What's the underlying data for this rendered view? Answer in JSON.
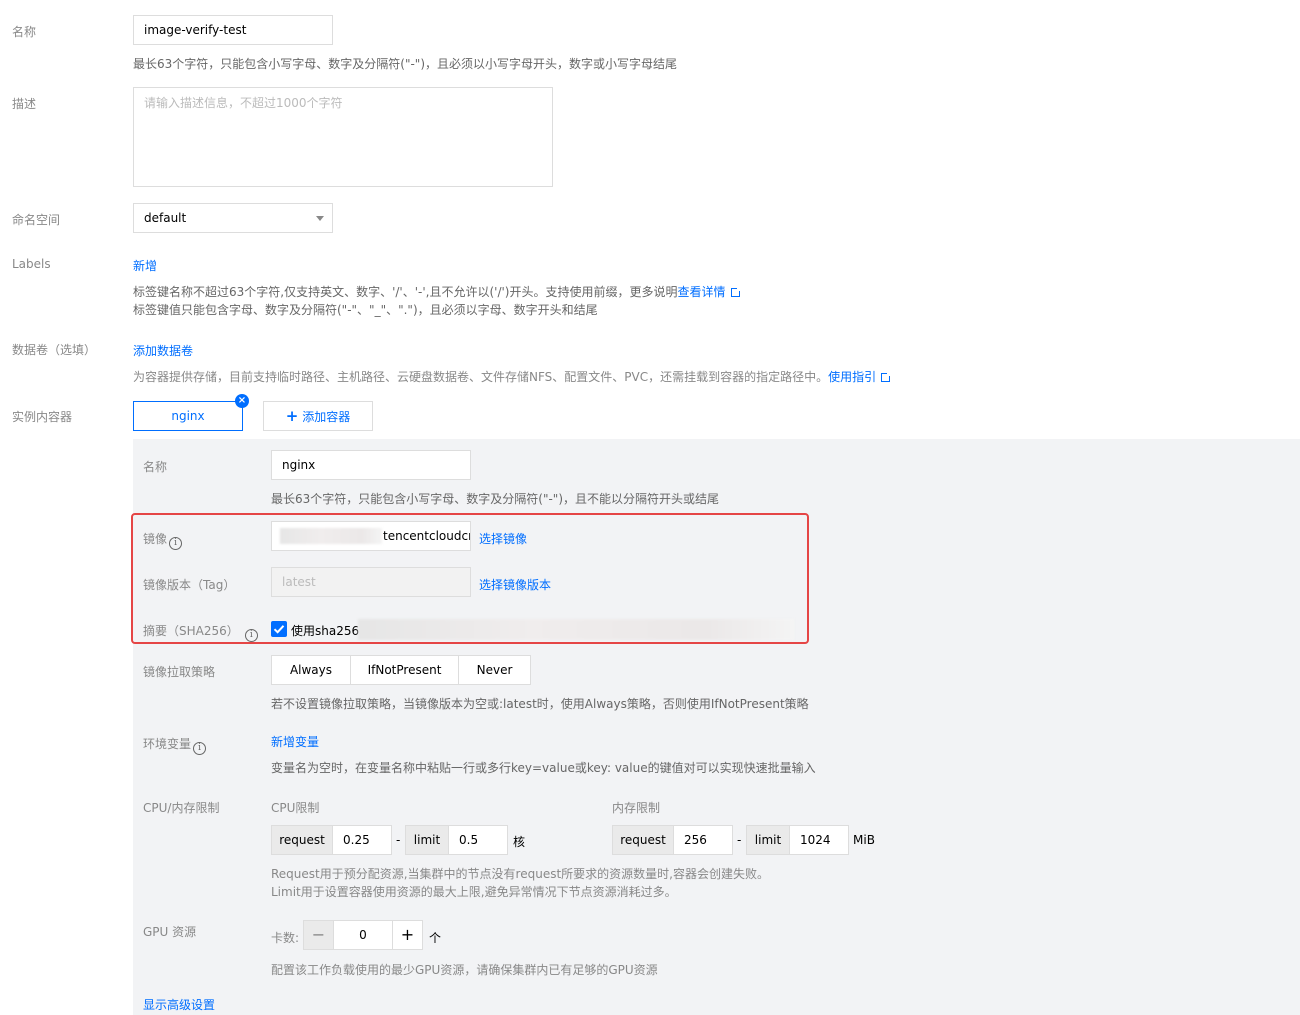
{
  "form": {
    "name_label": "名称",
    "name_value": "image-verify-test",
    "name_hint": "最长63个字符，只能包含小写字母、数字及分隔符(\"-\")，且必须以小写字母开头，数字或小写字母结尾",
    "desc_label": "描述",
    "desc_placeholder": "请输入描述信息，不超过1000个字符",
    "namespace_label": "命名空间",
    "namespace_value": "default",
    "labels_label": "Labels",
    "labels_add": "新增",
    "labels_hint1": "标签键名称不超过63个字符,仅支持英文、数字、'/'、'-',且不允许以('/')开头。支持使用前缀，更多说明",
    "labels_hint1_link": "查看详情",
    "labels_hint2": "标签键值只能包含字母、数字及分隔符(\"-\"、\"_\"、\".\")，且必须以字母、数字开头和结尾",
    "volumes_label": "数据卷（选填）",
    "volumes_add": "添加数据卷",
    "volumes_hint": "为容器提供存储，目前支持临时路径、主机路径、云硬盘数据卷、文件存储NFS、配置文件、PVC，还需挂载到容器的指定路径中。",
    "volumes_hint_link": "使用指引",
    "containers_label": "实例内容器",
    "container_tab": "nginx",
    "add_container": "添加容器"
  },
  "container": {
    "name_label": "名称",
    "name_value": "nginx",
    "name_hint": "最长63个字符，只能包含小写字母、数字及分隔符(\"-\")，且不能以分隔符开头或结尾",
    "image_label": "镜像",
    "image_value": "tencentcloudcr",
    "image_select": "选择镜像",
    "tag_label": "镜像版本（Tag）",
    "tag_value": "latest",
    "tag_select": "选择镜像版本",
    "digest_label": "摘要（SHA256）",
    "digest_checkbox": "使用sha256:",
    "pull_label": "镜像拉取策略",
    "pull_options": [
      "Always",
      "IfNotPresent",
      "Never"
    ],
    "pull_hint": "若不设置镜像拉取策略，当镜像版本为空或:latest时，使用Always策略，否则使用IfNotPresent策略",
    "env_label": "环境变量",
    "env_add": "新增变量",
    "env_hint": "变量名为空时，在变量名称中粘贴一行或多行key=value或key: value的键值对可以实现快速批量输入",
    "cpu_mem_label": "CPU/内存限制",
    "cpu_title": "CPU限制",
    "mem_title": "内存限制",
    "request": "request",
    "limit": "limit",
    "cpu_request": "0.25",
    "cpu_limit": "0.5",
    "cpu_unit": "核",
    "mem_request": "256",
    "mem_limit": "1024",
    "mem_unit": "MiB",
    "dash": "-",
    "res_hint1": "Request用于预分配资源,当集群中的节点没有request所要求的资源数量时,容器会创建失败。",
    "res_hint2": "Limit用于设置容器使用资源的最大上限,避免异常情况下节点资源消耗过多。",
    "gpu_label": "GPU 资源",
    "gpu_count_label": "卡数:",
    "gpu_value": "0",
    "gpu_unit": "个",
    "gpu_minus": "−",
    "gpu_plus": "+",
    "gpu_hint": "配置该工作负载使用的最少GPU资源，请确保集群内已有足够的GPU资源",
    "advanced": "显示高级设置"
  },
  "colors": {
    "link": "#006eff",
    "highlight_border": "#e54545",
    "panel": "#f2f3f5"
  }
}
